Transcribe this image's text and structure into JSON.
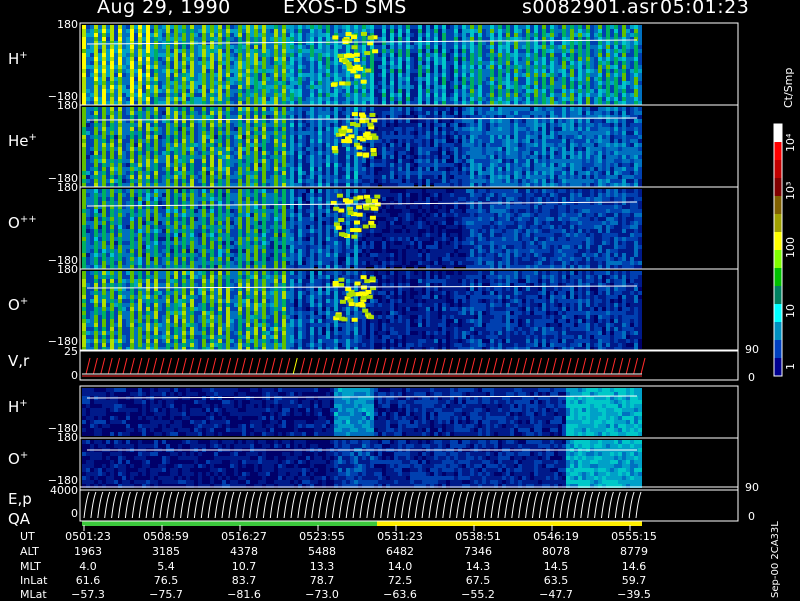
{
  "header": {
    "date": "Aug 29, 1990",
    "mission": "EXOS-D SMS",
    "file": "s0082901.asr",
    "time": "05:01:23"
  },
  "panels": [
    {
      "label": "H",
      "charge": "+",
      "top_tick": "180",
      "bottom_tick": "−180"
    },
    {
      "label": "He",
      "charge": "+",
      "top_tick": "180",
      "bottom_tick": "−180"
    },
    {
      "label": "O",
      "charge": "++",
      "top_tick": "180",
      "bottom_tick": "−180"
    },
    {
      "label": "O",
      "charge": "+",
      "top_tick": "180",
      "bottom_tick": "−180"
    },
    {
      "label": "V,r",
      "charge": "",
      "top_tick": "25",
      "bottom_tick": "0",
      "right_top": "90",
      "right_bottom": "0"
    },
    {
      "label": "H",
      "charge": "+",
      "top_tick": "",
      "bottom_tick": "−180"
    },
    {
      "label": "O",
      "charge": "+",
      "top_tick": "180",
      "bottom_tick": "−180"
    },
    {
      "label": "E,p",
      "charge": "",
      "top_tick": "4000",
      "bottom_tick": "0",
      "right_top": "90",
      "right_bottom": "0"
    }
  ],
  "qa_label": "QA",
  "colorbar": {
    "unit": "Ct/Smp",
    "labels": [
      "10⁴",
      "10³",
      "100",
      "10",
      "1"
    ],
    "colors": [
      "#ffffff",
      "#ff0000",
      "#c00000",
      "#800000",
      "#806000",
      "#a0a000",
      "#ffff00",
      "#80ff00",
      "#00c000",
      "#008060",
      "#00ffff",
      "#0090c0",
      "#0040c0",
      "#000090"
    ]
  },
  "table": {
    "rows": [
      {
        "name": "UT",
        "values": [
          "0501:23",
          "0508:59",
          "0516:27",
          "0523:55",
          "0531:23",
          "0538:51",
          "0546:19",
          "0555:15"
        ]
      },
      {
        "name": "ALT",
        "values": [
          "1963",
          "3185",
          "4378",
          "5488",
          "6482",
          "7346",
          "8078",
          "8779"
        ]
      },
      {
        "name": "MLT",
        "values": [
          "4.0",
          "5.4",
          "10.7",
          "13.3",
          "14.0",
          "14.3",
          "14.5",
          "14.6"
        ]
      },
      {
        "name": "InLat",
        "values": [
          "61.6",
          "76.5",
          "83.7",
          "78.7",
          "72.5",
          "67.5",
          "63.5",
          "59.7"
        ]
      },
      {
        "name": "MLat",
        "values": [
          "−57.3",
          "−75.7",
          "−81.6",
          "−73.0",
          "−63.6",
          "−55.2",
          "−47.7",
          "−39.5"
        ]
      }
    ]
  },
  "side_id": "Sep-00  2CA33L",
  "chart_data": {
    "type": "heatmap",
    "title": "Aug 29, 1990   EXOS-D SMS   s0082901.asr   05:01:23",
    "x_ticks": [
      "0501:23",
      "0508:59",
      "0516:27",
      "0523:55",
      "0531:23",
      "0538:51",
      "0546:19",
      "0555:15"
    ],
    "colorbar_unit": "Ct/Smp",
    "colorbar_ticks": [
      "1",
      "10",
      "100",
      "10³",
      "10⁴"
    ]
  }
}
